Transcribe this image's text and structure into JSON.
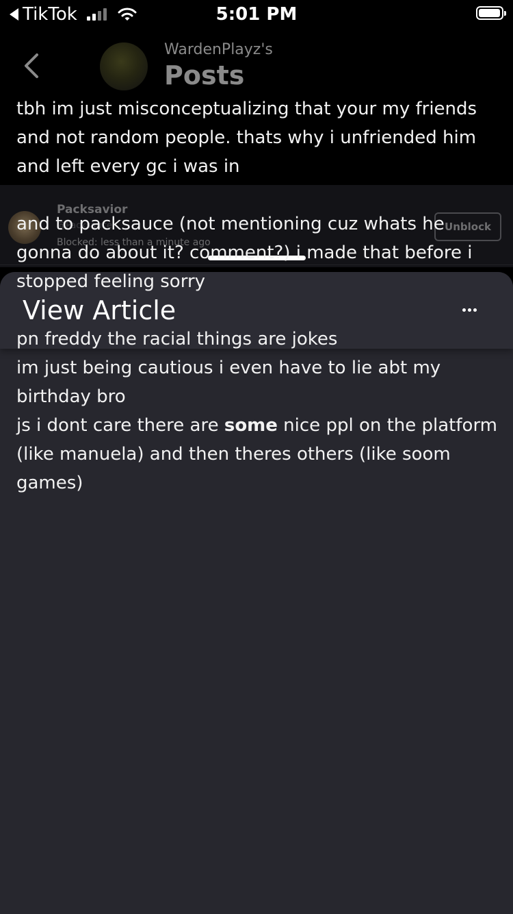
{
  "status_bar": {
    "back_app": "TikTok",
    "time": "5:01 PM",
    "signal_bars": 2,
    "battery_level": 0.85
  },
  "header": {
    "owner": "WardenPlayz's",
    "title": "Posts",
    "back_icon": "chevron-left-icon"
  },
  "blocked_user": {
    "name": "Packsavior",
    "handle": "@Packsauce",
    "blocked_time": "Blocked: less than a minute ago",
    "button_label": "Unblock"
  },
  "sheet": {
    "title": "View Article",
    "more_icon": "more-horizontal-icon"
  },
  "article": {
    "para1": "tbh im just misconceptualizing that your my friends and not random people. thats why i unfriended him and left every gc i was in",
    "para2": "and to packsauce (not mentioning cuz whats he gonna do about it? comment?) i made that before i stopped feeling sorry",
    "line3": "pn freddy the racial things are jokes",
    "line4": "im just being cautious i even have to lie abt my birthday bro",
    "line5_pre": "js i dont care there are ",
    "line5_bold": "some",
    "line5_post": " nice ppl on the platform (like manuela) and then theres others (like soom games)"
  }
}
